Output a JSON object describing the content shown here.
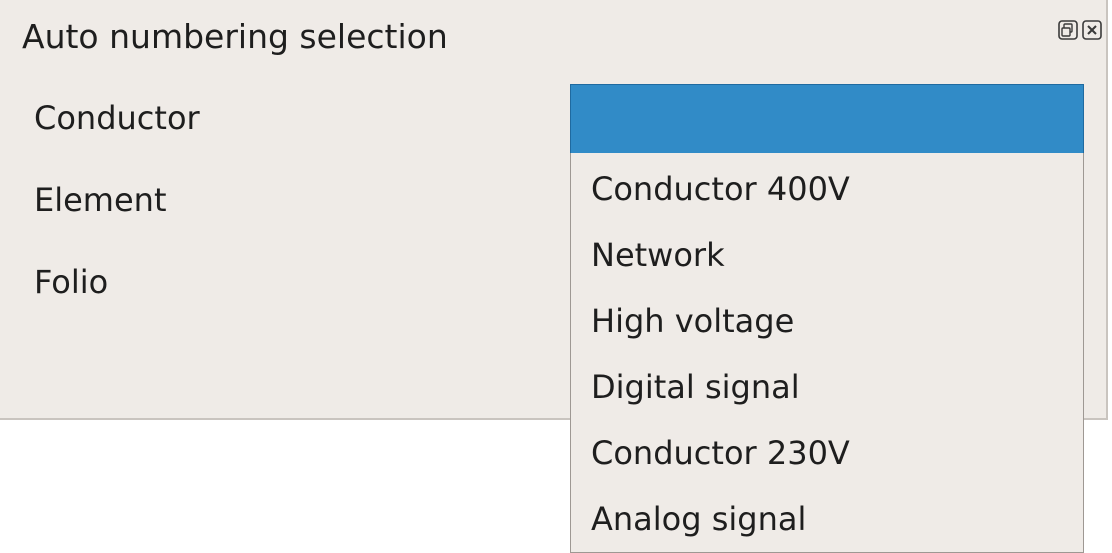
{
  "window": {
    "title": "Auto numbering selection"
  },
  "labels": [
    "Conductor",
    "Element",
    "Folio"
  ],
  "combo": {
    "selected": ""
  },
  "dropdown": {
    "options": [
      "Conductor 400V",
      "Network",
      "High voltage",
      "Digital signal",
      "Conductor 230V",
      "Analog signal"
    ]
  },
  "colors": {
    "panel_bg": "#efebe7",
    "highlight": "#318bc7",
    "text": "#1e1e1e"
  },
  "icons": [
    "float-icon",
    "close-icon"
  ]
}
